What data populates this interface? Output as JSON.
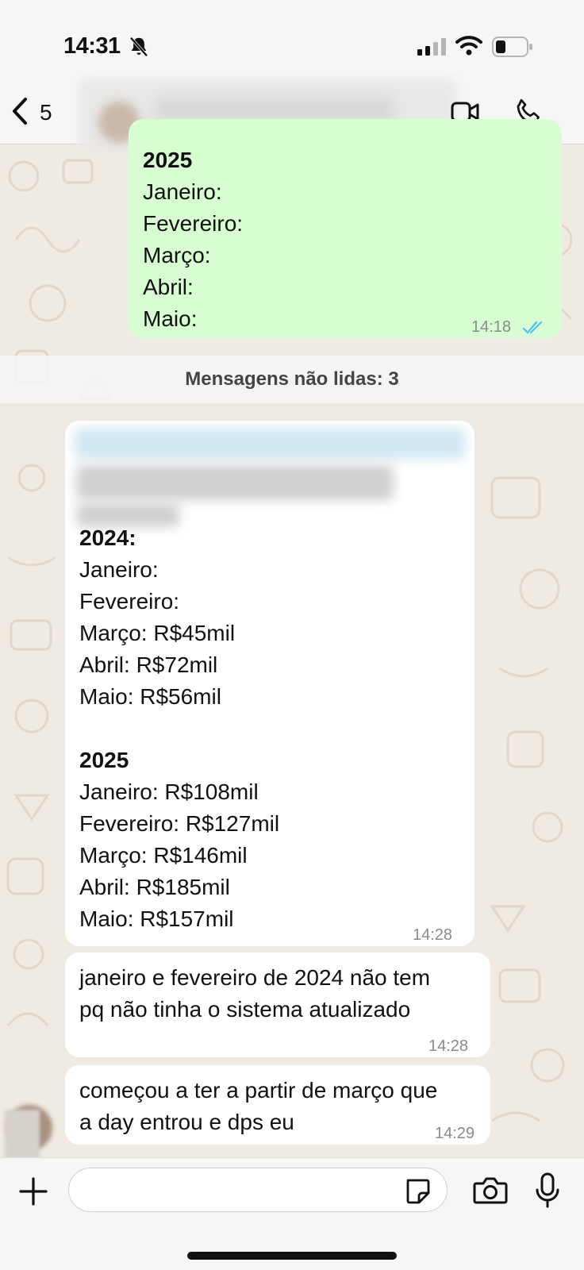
{
  "status_bar": {
    "time": "14:31"
  },
  "header": {
    "back_count": "5"
  },
  "messages": {
    "out_1": {
      "lines": [
        "2025",
        "Janeiro:",
        "Fevereiro:",
        "Março:",
        "Abril:",
        "Maio:"
      ],
      "time": "14:18",
      "status": "read-double-check"
    },
    "unread_banner": "Mensagens não lidas: 3",
    "in_1": {
      "heading_2024": "2024:",
      "lines_2024": [
        "Janeiro:",
        "Fevereiro:",
        "Março: R$45mil",
        "Abril: R$72mil",
        "Maio: R$56mil"
      ],
      "heading_2025": "2025",
      "lines_2025": [
        "Janeiro: R$108mil",
        "Fevereiro: R$127mil",
        "Março: R$146mil",
        "Abril: R$185mil",
        "Maio: R$157mil"
      ],
      "time": "14:28"
    },
    "in_2": {
      "lines": [
        "janeiro e fevereiro de 2024 não tem",
        "pq não tinha o sistema atualizado"
      ],
      "time": "14:28"
    },
    "in_3": {
      "lines": [
        "começou a ter a partir de março que",
        "a day entrou e dps eu"
      ],
      "time": "14:29"
    }
  },
  "input": {
    "placeholder": ""
  },
  "colors": {
    "outgoing_bubble": "#d9fdd3",
    "incoming_bubble": "#ffffff",
    "read_check": "#53bdeb",
    "wallpaper": "#efeae2"
  },
  "icons": [
    "mute-bell-icon",
    "signal-icon",
    "wifi-icon",
    "battery-icon",
    "back-chevron-icon",
    "video-call-icon",
    "phone-icon",
    "plus-icon",
    "sticker-icon",
    "camera-icon",
    "microphone-icon"
  ]
}
